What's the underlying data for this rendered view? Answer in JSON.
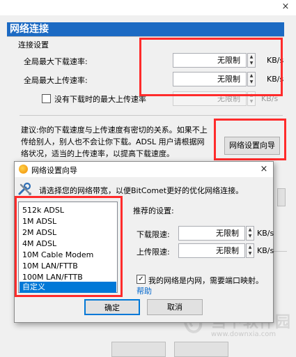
{
  "panel": {
    "title": "网络连接",
    "section": "连接设置",
    "max_download_label": "全局最大下载速率:",
    "max_download_value": "无限制",
    "max_upload_label": "全局最大上传速率:",
    "max_upload_value": "无限制",
    "unit": "KB/s",
    "no_task_upload_label": "没有下载时的最大上传速率",
    "no_task_upload_value": "无限制",
    "advice_line1": "建议:你的下载速度与上传速度有密切的关系。如果不上",
    "advice_line2": "传给别人，别人也不会让你下载。ADSL 用户请根据网",
    "advice_line3": "络状况，适当的上传速率，以提高下载速度。",
    "wizard_button": "网络设置向导"
  },
  "dialog": {
    "title": "网络设置向导",
    "close": "×",
    "hint": "请选择您的网络带宽，以便BitComet更好的优化网络连接。",
    "bandwidth_options": [
      "512k ADSL",
      "1M ADSL",
      "2M ADSL",
      "4M ADSL",
      "10M Cable Modem",
      "10M LAN/FTTB",
      "100M LAN/FTTB",
      "自定义"
    ],
    "selected_option": "自定义",
    "recommended_label": "推荐的设置:",
    "download_limit_label": "下载限速:",
    "download_limit_value": "无限制",
    "upload_limit_label": "上传限速:",
    "upload_limit_value": "无限制",
    "unit": "KB/s",
    "lan_checkbox_label": "我的网络是内网，需要端口映射。",
    "lan_checked": true,
    "help_link": "帮助",
    "ok_button": "确定",
    "cancel_button": "取消"
  },
  "window": {
    "close": "×"
  },
  "watermark": {
    "text": "当下软件园",
    "url": "www.downxia.com"
  },
  "colors": {
    "title_bar": "#1c6ac3",
    "highlight": "#ff2b2b",
    "selection": "#0078d7",
    "link": "#0066cc"
  }
}
